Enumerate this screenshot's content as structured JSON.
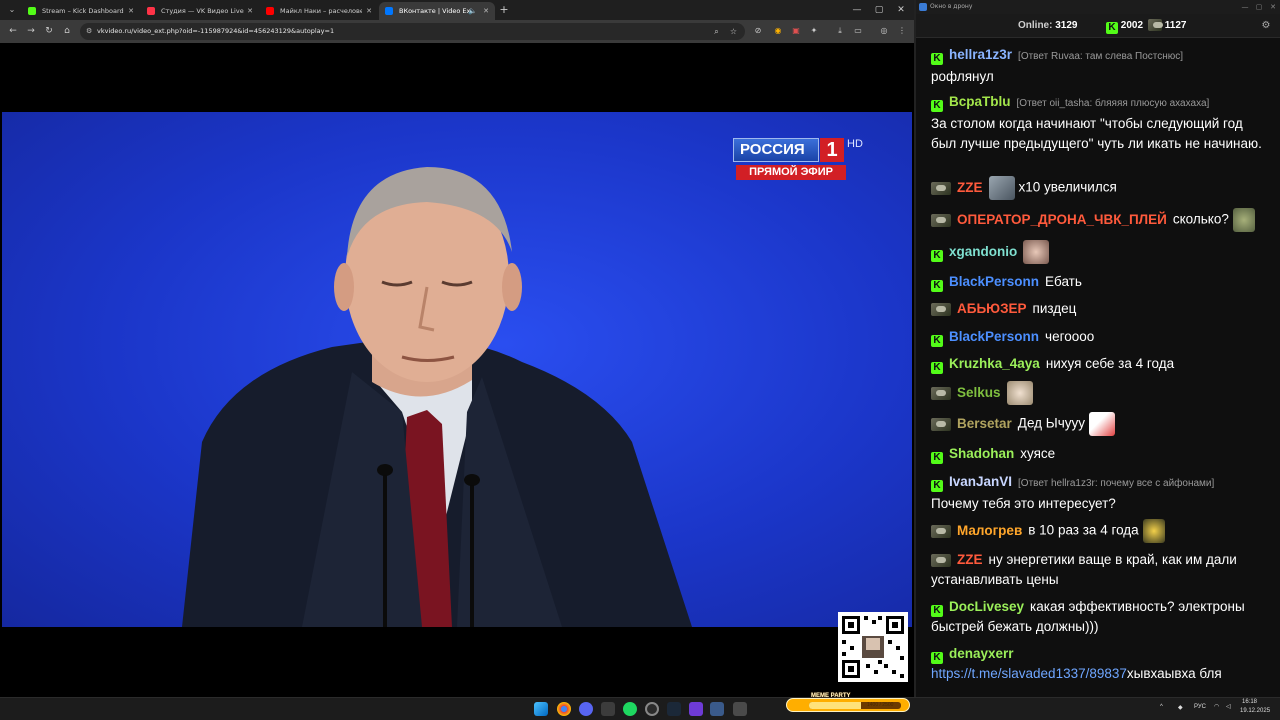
{
  "browser": {
    "tabs": [
      {
        "label": "Stream – Kick Dashboard",
        "favicon_color": "#53fc18"
      },
      {
        "label": "Студия — VK Видео Live",
        "favicon_color": "#ff3347"
      },
      {
        "label": "Майкл Наки – расчеловечива",
        "favicon_color": "#ff0000"
      },
      {
        "label": "ВКонтакте | Video Ext",
        "favicon_color": "#0077ff"
      }
    ],
    "url": "vkvideo.ru/video_ext.php?oid=-115987924&id=456243129&autoplay=1"
  },
  "video": {
    "channel_name": "РОССИЯ",
    "channel_number": "1",
    "hd_label": "HD",
    "live_label": "ПРЯМОЙ ЭФИР"
  },
  "chat": {
    "window_title": "Окно в дрону",
    "online_label": "Online:",
    "online_count": "3129",
    "kick_count": "2002",
    "vk_count": "1127",
    "messages": [
      {
        "platform": "kick",
        "user": "hellra1z3r",
        "color": "#8ab4ff",
        "reply": "[Ответ Ruvaa: там слева Постснюс]",
        "text": "рофлянул"
      },
      {
        "platform": "kick",
        "user": "BcpaTblu",
        "color": "#a3e64b",
        "reply": "[Ответ oii_tasha: бляяяя плюсую ахахаха]",
        "text": "За столом когда начинают \"чтобы следующий год был лучше предыдущего\" чуть ли икать не начинаю."
      },
      {
        "platform": "vk",
        "user": "ZZE",
        "color": "#ff5a3c",
        "text": "x10 увеличился"
      },
      {
        "platform": "vk",
        "user": "ОПЕРАТОР_ДРОНА_ЧВК_ПЛЕЙ",
        "color": "#ff5a3c",
        "text": "сколько?"
      },
      {
        "platform": "kick",
        "user": "xgandonio",
        "color": "#7fe0d0",
        "text": ""
      },
      {
        "platform": "kick",
        "user": "BlackPersonn",
        "color": "#4c8fff",
        "text": "Ебать"
      },
      {
        "platform": "vk",
        "user": "АБЬЮЗЕР",
        "color": "#ff5a3c",
        "text": "пиздец"
      },
      {
        "platform": "kick",
        "user": "BlackPersonn",
        "color": "#4c8fff",
        "text": "чегоооо"
      },
      {
        "platform": "kick",
        "user": "Kruzhka_4aya",
        "color": "#9bef5a",
        "text": "нихуя себе за 4 года"
      },
      {
        "platform": "vk",
        "user": "Selkus",
        "color": "#7fbf3f",
        "text": ""
      },
      {
        "platform": "vk",
        "user": "Bersetar",
        "color": "#b0a35f",
        "text": "Дед Ычууу"
      },
      {
        "platform": "kick",
        "user": "Shadohan",
        "color": "#9bef5a",
        "text": "хуясе"
      },
      {
        "platform": "kick",
        "user": "IvanJanVI",
        "color": "#c8d6ff",
        "reply": "[Ответ hellra1z3r: почему все с айфонами]",
        "text": "Почему тебя это интересует?"
      },
      {
        "platform": "vk",
        "user": "Малогрев",
        "color": "#ffa62b",
        "text": "в 10 раз за 4 года"
      },
      {
        "platform": "vk",
        "user": "ZZE",
        "color": "#ff5a3c",
        "text": "ну энергетики ваще в край, как им дали устанавливать цены"
      },
      {
        "platform": "kick",
        "user": "DocLivesey",
        "color": "#9bef5a",
        "text": "какая эффективность? электроны быстрей бежать должны)))"
      },
      {
        "platform": "kick",
        "user": "denayxerr",
        "color": "#9bef5a",
        "link": "https://t.me/slavaded1337/89837",
        "text": "хывхаывха бля"
      }
    ]
  },
  "taskbar": {
    "meme_title": "MEME PARTY",
    "meme_progress": "1400 / 2500",
    "meme_fraction": 0.56,
    "lang": "РУС",
    "time": "16:18",
    "date": "19.12.2025"
  }
}
